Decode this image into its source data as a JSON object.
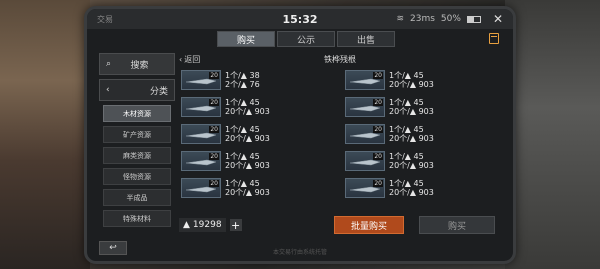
{
  "statusbar": {
    "app": "交易",
    "time": "15:32",
    "network": "23ms",
    "battery": "50%"
  },
  "tabs": [
    {
      "label": "购买",
      "active": true
    },
    {
      "label": "公示",
      "active": false
    },
    {
      "label": "出售",
      "active": false
    }
  ],
  "sidebar": {
    "search": "搜索",
    "category": "分类",
    "items": [
      {
        "label": "木材资源",
        "active": true
      },
      {
        "label": "矿产资源",
        "active": false
      },
      {
        "label": "麻类资源",
        "active": false
      },
      {
        "label": "怪物资源",
        "active": false
      },
      {
        "label": "半成品",
        "active": false
      },
      {
        "label": "特殊材料",
        "active": false
      }
    ]
  },
  "main": {
    "back": "返回",
    "title": "铁桦残根",
    "listings": [
      {
        "level": "20",
        "line1": "1个/▲ 38",
        "line2": "2个/▲ 76"
      },
      {
        "level": "20",
        "line1": "1个/▲ 45",
        "line2": "20个/▲ 903"
      },
      {
        "level": "20",
        "line1": "1个/▲ 45",
        "line2": "20个/▲ 903"
      },
      {
        "level": "20",
        "line1": "1个/▲ 45",
        "line2": "20个/▲ 903"
      },
      {
        "level": "20",
        "line1": "1个/▲ 45",
        "line2": "20个/▲ 903"
      },
      {
        "level": "20",
        "line1": "1个/▲ 45",
        "line2": "20个/▲ 903"
      },
      {
        "level": "20",
        "line1": "1个/▲ 45",
        "line2": "20个/▲ 903"
      },
      {
        "level": "20",
        "line1": "1个/▲ 45",
        "line2": "20个/▲ 903"
      },
      {
        "level": "20",
        "line1": "1个/▲ 45",
        "line2": "20个/▲ 903"
      },
      {
        "level": "20",
        "line1": "1个/▲ 45",
        "line2": "20个/▲ 903"
      }
    ]
  },
  "bottom": {
    "money": "19298",
    "plus": "+",
    "bulk_buy": "批量购买",
    "buy": "购买"
  },
  "footer": {
    "back": "↩",
    "note": "本交易行由系统托管"
  },
  "colors": {
    "accent": "#b04a1c",
    "panel": "#1c1e20"
  }
}
